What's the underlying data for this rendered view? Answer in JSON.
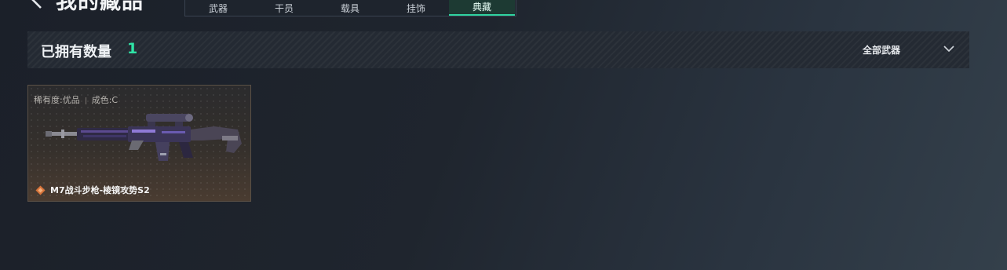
{
  "header": {
    "title": "我的藏品",
    "tabs": [
      {
        "label": "武器",
        "active": false
      },
      {
        "label": "干员",
        "active": false
      },
      {
        "label": "载具",
        "active": false
      },
      {
        "label": "挂饰",
        "active": false
      },
      {
        "label": "典藏",
        "active": true
      }
    ]
  },
  "summary": {
    "owned_label": "已拥有数量",
    "owned_count": "1",
    "filter_label": "全部武器"
  },
  "items": [
    {
      "rarity_text": "稀有度:优品",
      "condition_text": "成色:C",
      "name": "M7战斗步枪-棱镜攻势S2"
    }
  ],
  "colors": {
    "accent": "#2fe3a6",
    "rarity_orange": "#d8743a"
  },
  "icons": [
    "back-icon",
    "chevron-down-icon",
    "rarity-diamond-icon"
  ]
}
